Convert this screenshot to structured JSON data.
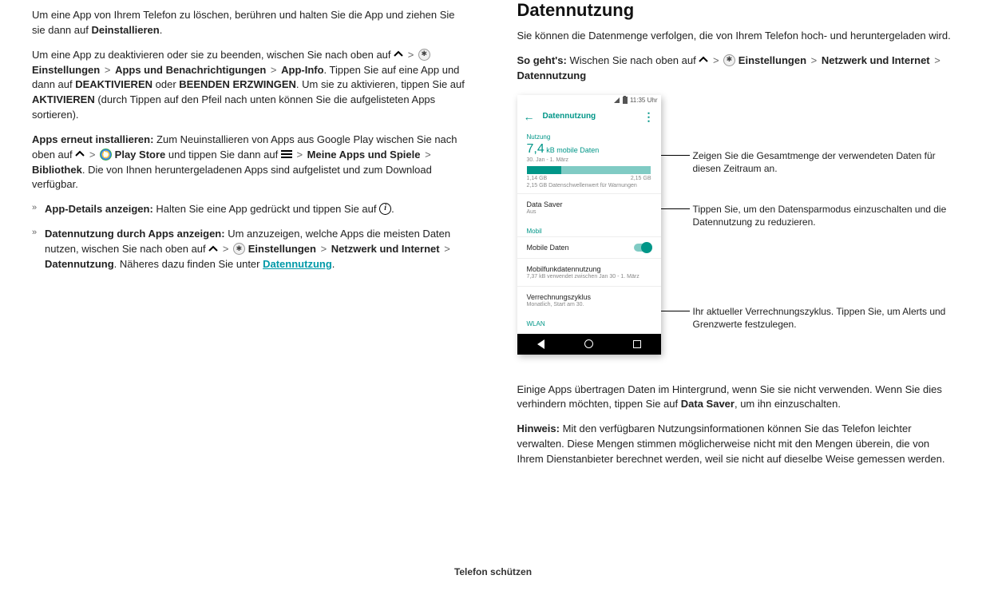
{
  "left": {
    "p1_a": "Um eine App von Ihrem Telefon zu löschen, berühren und halten Sie die App und ziehen Sie sie dann auf ",
    "p1_b": "Deinstallieren",
    "p1_c": ".",
    "p2_a": "Um eine App zu deaktivieren oder sie zu beenden, wischen Sie nach oben auf ",
    "p2_sep": " > ",
    "p2_set": "Einstellungen",
    "p2_apps": "Apps und Benachrichtigungen",
    "p2_appinfo": "App-Info",
    "p2_b": ". Tippen Sie auf eine App und dann auf ",
    "p2_deact": "DEAKTIVIEREN",
    "p2_or": " oder ",
    "p2_force": "BEENDEN ERZWINGEN",
    "p2_c": ". Um sie zu aktivieren, tippen Sie auf ",
    "p2_act": "AKTIVIEREN",
    "p2_d": " (durch Tippen auf den Pfeil nach unten können Sie die aufgelisteten Apps sortieren).",
    "p3_label": "Apps erneut installieren:",
    "p3_a": " Zum Neuinstallieren von Apps aus Google Play wischen Sie nach oben auf ",
    "p3_play": "Play Store",
    "p3_b": " und tippen Sie dann auf ",
    "p3_my": "Meine Apps und Spiele",
    "p3_lib": "Bibliothek",
    "p3_c": ". Die von Ihnen heruntergeladenen Apps sind aufgelistet und zum Download verfügbar.",
    "b1_label": "App-Details anzeigen:",
    "b1_text": " Halten Sie eine App gedrückt und tippen Sie auf ",
    "b1_end": ".",
    "b2_label": "Datennutzung durch Apps anzeigen:",
    "b2_a": " Um anzuzeigen, welche Apps die meisten Daten nutzen, wischen Sie nach oben auf ",
    "b2_set": "Einstellungen",
    "b2_net": "Netzwerk und Internet",
    "b2_data": "Datennutzung",
    "b2_b": ". Näheres dazu finden Sie unter ",
    "b2_link": "Datennutzung",
    "b2_end": "."
  },
  "right": {
    "heading": "Datennutzung",
    "intro": "Sie können die Datenmenge verfolgen, die von Ihrem Telefon hoch- und heruntergeladen wird.",
    "so_label": "So geht's:",
    "so_a": " Wischen Sie nach oben auf ",
    "so_set": "Einstellungen",
    "so_net": "Netzwerk und Internet",
    "so_data": "Datennutzung",
    "so_sep": " > ",
    "callout1": "Zeigen Sie die Gesamtmenge der verwendeten Daten für diesen Zeitraum an.",
    "callout2": "Tippen Sie, um den Datensparmodus einzuschalten und die Datennutzung zu reduzieren.",
    "callout3": "Ihr aktueller Verrechnungszyklus. Tippen Sie, um Alerts und Grenzwerte festzulegen.",
    "p_bg_a": "Einige Apps übertragen Daten im Hintergrund, wenn Sie sie nicht verwenden. Wenn Sie dies verhindern möchten, tippen Sie auf ",
    "p_bg_b": "Data Saver",
    "p_bg_c": ", um ihn einzuschalten.",
    "note_label": "Hinweis:",
    "note": " Mit den verfügbaren Nutzungsinformationen können Sie das Telefon leichter verwalten. Diese Mengen stimmen möglicherweise nicht mit den Mengen überein, die von Ihrem Dienstanbieter berechnet werden, weil sie nicht auf dieselbe Weise gemessen werden."
  },
  "phone": {
    "time": "11:35 Uhr",
    "title": "Datennutzung",
    "sec_usage": "Nutzung",
    "usage_val": "7,4",
    "usage_unit": "kB mobile Daten",
    "usage_range": "30. Jan - 1. März",
    "limit_low": "1,14 GB",
    "limit_high": "2,15 GB",
    "limit_note": "2,15 GB Datenschwellenwert für Warnungen",
    "saver_title": "Data Saver",
    "saver_sub": "Aus",
    "sec_mobil": "Mobil",
    "mobile_data": "Mobile Daten",
    "mobile_usage_title": "Mobilfunkdatennutzung",
    "mobile_usage_sub": "7,37 kB verwendet zwischen Jan 30 - 1. März",
    "billing_title": "Verrechnungszyklus",
    "billing_sub": "Monatlich, Start am 30.",
    "sec_wlan": "WLAN"
  },
  "footer": "Telefon schützen"
}
